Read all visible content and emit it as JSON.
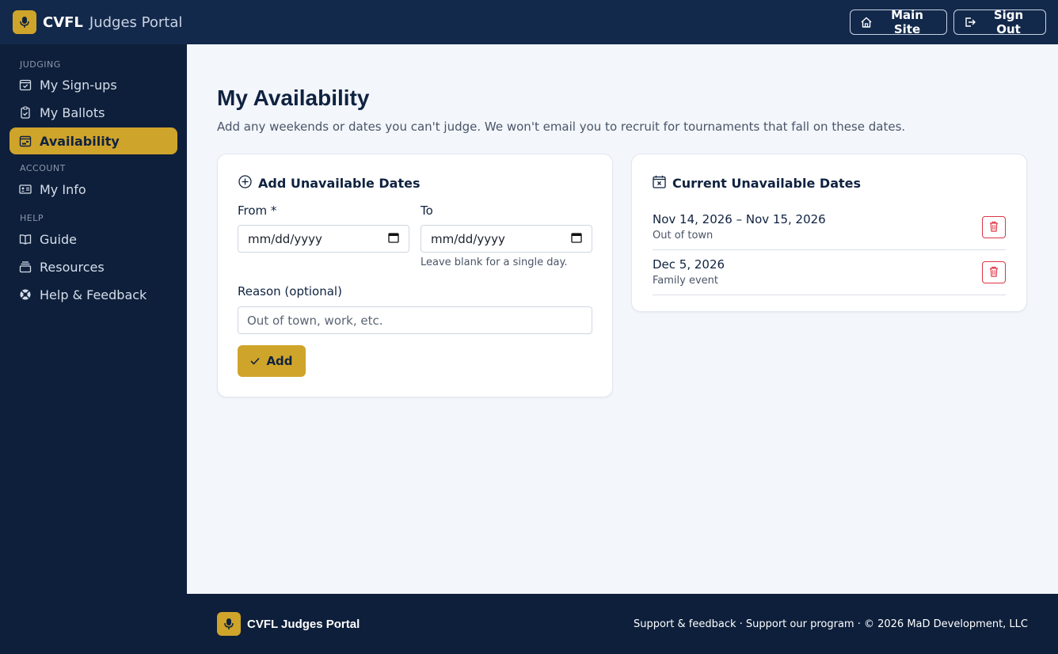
{
  "header": {
    "brand_name": "CVFL",
    "brand_sub": "Judges Portal",
    "main_site_label": "Main Site",
    "sign_out_label": "Sign Out"
  },
  "sidebar": {
    "sections": [
      {
        "title": "JUDGING",
        "items": [
          {
            "label": "My Sign-ups",
            "icon": "calendar-check-icon"
          },
          {
            "label": "My Ballots",
            "icon": "clipboard-check-icon"
          },
          {
            "label": "Availability",
            "icon": "calendar-week-icon",
            "active": true
          }
        ]
      },
      {
        "title": "ACCOUNT",
        "items": [
          {
            "label": "My Info",
            "icon": "id-card-icon"
          }
        ]
      },
      {
        "title": "HELP",
        "items": [
          {
            "label": "Guide",
            "icon": "book-icon"
          },
          {
            "label": "Resources",
            "icon": "collection-icon"
          },
          {
            "label": "Help & Feedback",
            "icon": "life-preserver-icon"
          }
        ]
      }
    ]
  },
  "page": {
    "title": "My Availability",
    "subtitle": "Add any weekends or dates you can't judge. We won't email you to recruit for tournaments that fall on these dates."
  },
  "add_card": {
    "title": "Add Unavailable Dates",
    "from_label": "From *",
    "from_value": "mm/dd/yyyy",
    "to_label": "To",
    "to_value": "mm/dd/yyyy",
    "to_hint": "Leave blank for a single day.",
    "reason_label": "Reason (optional)",
    "reason_placeholder": "Out of town, work, etc.",
    "add_label": "Add"
  },
  "current_card": {
    "title": "Current Unavailable Dates",
    "dates": [
      {
        "range": "Nov 14, 2026 – Nov 15, 2026",
        "reason": "Out of town"
      },
      {
        "range": "Dec 5, 2026",
        "reason": "Family event"
      }
    ]
  },
  "footer": {
    "brand": "CVFL Judges Portal",
    "links": "Support & feedback · Support our program · © 2026 MaD Development, LLC"
  },
  "colors": {
    "navy": "#13294b",
    "sidebar": "#0e1f3b",
    "gold": "#cfa42a",
    "danger": "#dc3545"
  }
}
